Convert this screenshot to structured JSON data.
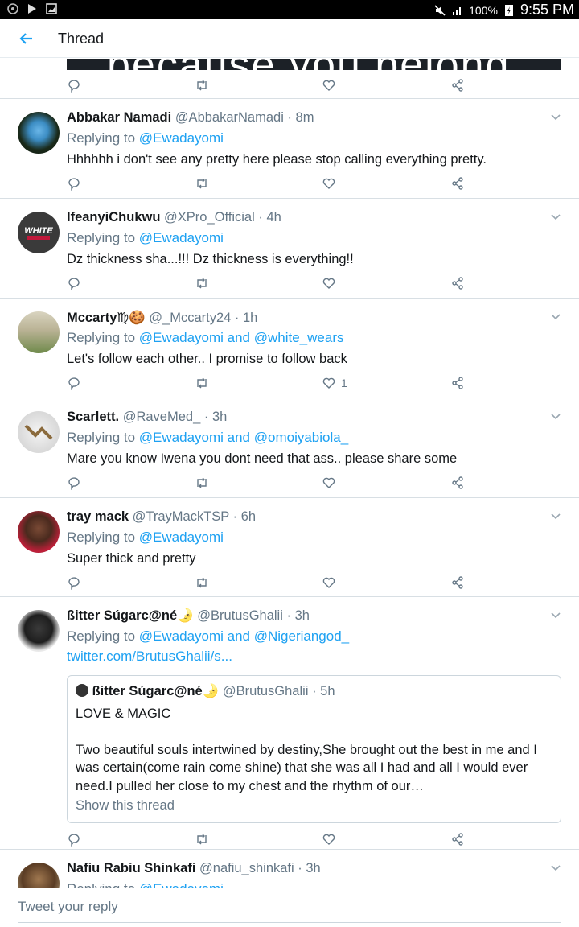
{
  "status_bar": {
    "battery": "100%",
    "time": "9:55 PM"
  },
  "header": {
    "title": "Thread"
  },
  "top_media": {
    "text": "because you belong"
  },
  "tweets": [
    {
      "name": "Abbakar Namadi",
      "handle": "@AbbakarNamadi",
      "time": "· 8m",
      "replying_prefix": "Replying to",
      "replying_to": "@Ewadayomi",
      "text": "Hhhhhh i don't see any pretty here please stop calling everything pretty.",
      "like_count": ""
    },
    {
      "name": "IfeanyiChukwu",
      "handle": "@XPro_Official",
      "time": "· 4h",
      "replying_prefix": "Replying to",
      "replying_to": "@Ewadayomi",
      "text": "Dz thickness sha...!!! Dz thickness is everything!!",
      "like_count": ""
    },
    {
      "name": "Mccarty♍🍪",
      "handle": "@_Mccarty24",
      "time": "· 1h",
      "replying_prefix": "Replying to",
      "replying_to": "@Ewadayomi and @white_wears",
      "text": "Let's follow each other.. I promise to follow back",
      "like_count": "1"
    },
    {
      "name": "Scarlett.",
      "handle": "@RaveMed_",
      "time": "· 3h",
      "replying_prefix": "Replying to",
      "replying_to": "@Ewadayomi and @omoiyabiola_",
      "text": "Mare you know Iwena you dont need that ass..  please share some",
      "like_count": ""
    },
    {
      "name": "tray mack",
      "handle": "@TrayMackTSP",
      "time": "· 6h",
      "replying_prefix": "Replying to",
      "replying_to": "@Ewadayomi",
      "text": "Super thick and pretty",
      "like_count": ""
    },
    {
      "name": "ßitter Súgarc@né🌛",
      "handle": "@BrutusGhalii",
      "time": "· 3h",
      "replying_prefix": "Replying to",
      "replying_to": "@Ewadayomi and @Nigeriangod_",
      "link": "twitter.com/BrutusGhalii/s...",
      "like_count": "",
      "quote": {
        "name": "ßitter Súgarc@né🌛",
        "handle": "@BrutusGhalii",
        "time": "· 5h",
        "title": "LOVE & MAGIC",
        "body": "Two beautiful souls intertwined by destiny,She brought out the best in me and I was certain(come rain come shine) that she was all I had and all I would ever need.I pulled her close to my chest and the rhythm of our…",
        "show_thread": "Show this thread"
      }
    },
    {
      "name": "Nafiu Rabiu Shinkafi",
      "handle": "@nafiu_shinkafi",
      "time": "· 3h",
      "replying_prefix": "Replying to",
      "replying_to": "@Ewadayomi"
    }
  ],
  "composer": {
    "placeholder": "Tweet your reply"
  },
  "colors": {
    "link": "#1da1f2",
    "secondary_text": "#657786",
    "divider": "#d8dfe4",
    "back_arrow": "#1da1f2"
  }
}
